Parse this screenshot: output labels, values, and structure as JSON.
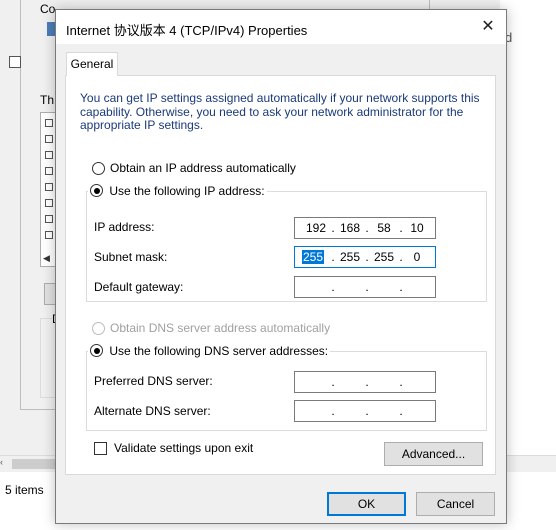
{
  "background": {
    "parent_label_partial": "Co",
    "right_text_partial": "d",
    "this_label_partial": "Th",
    "desc_label_partial": "D",
    "status_items": "5 items"
  },
  "dialog": {
    "title": "Internet 协议版本 4 (TCP/IPv4) Properties",
    "close_glyph": "✕",
    "tab_general": "General",
    "intro": "You can get IP settings assigned automatically if your network supports this capability. Otherwise, you need to ask your network administrator for the appropriate IP settings.",
    "ip_mode": {
      "auto_label": "Obtain an IP address automatically",
      "manual_label": "Use the following IP address:",
      "selected": "manual"
    },
    "ip_address": {
      "label": "IP address:",
      "octets": [
        "192",
        "168",
        "58",
        "10"
      ]
    },
    "subnet_mask": {
      "label": "Subnet mask:",
      "octets": [
        "255",
        "255",
        "255",
        "0"
      ],
      "selected_octet": "255"
    },
    "default_gateway": {
      "label": "Default gateway:",
      "octets": [
        "",
        "",
        "",
        ""
      ]
    },
    "dns_mode": {
      "auto_label": "Obtain DNS server address automatically",
      "manual_label": "Use the following DNS server addresses:",
      "selected": "manual"
    },
    "preferred_dns": {
      "label": "Preferred DNS server:",
      "octets": [
        "",
        "",
        "",
        ""
      ]
    },
    "alternate_dns": {
      "label": "Alternate DNS server:",
      "octets": [
        "",
        "",
        "",
        ""
      ]
    },
    "validate_label": "Validate settings upon exit",
    "validate_checked": false,
    "advanced_label": "Advanced...",
    "ok_label": "OK",
    "cancel_label": "Cancel",
    "dot": "."
  },
  "colors": {
    "accent": "#0078d7",
    "intro_text": "#1a3a7a"
  }
}
